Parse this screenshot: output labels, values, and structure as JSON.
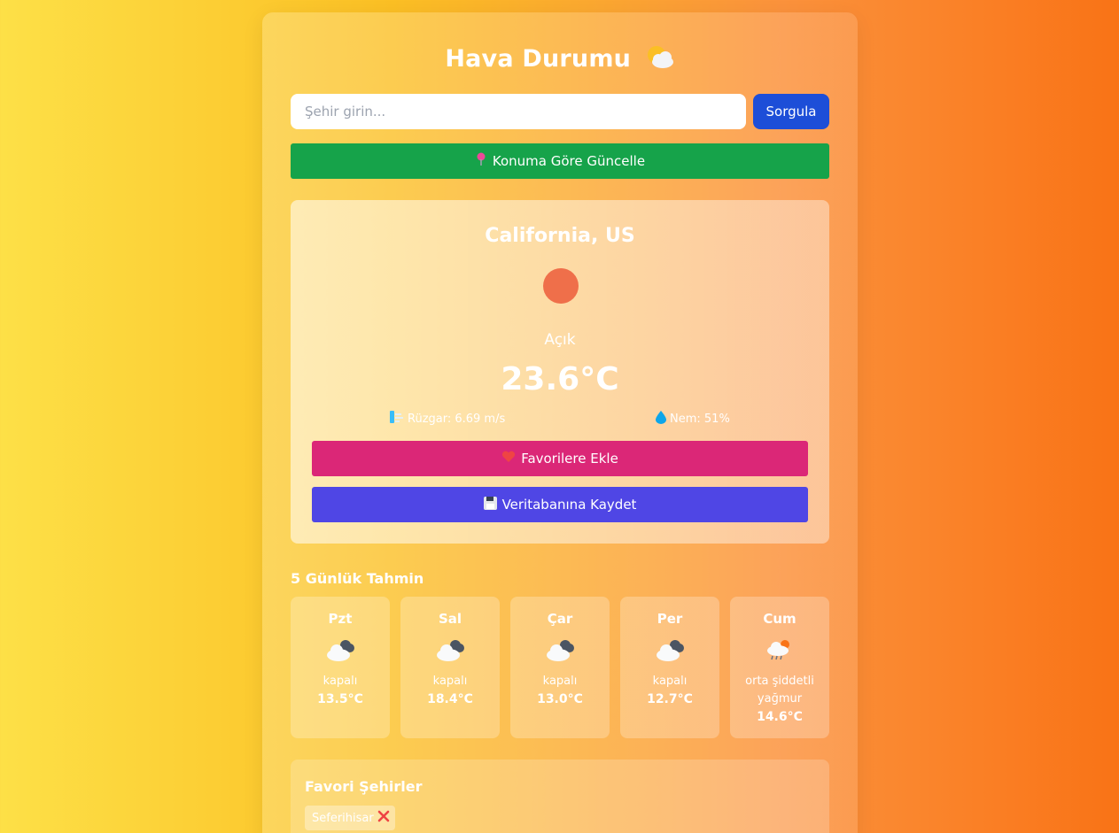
{
  "header": {
    "title": "Hava Durumu"
  },
  "search": {
    "placeholder": "Şehir girin...",
    "button_label": "Sorgula"
  },
  "location_button": {
    "label": "Konuma Göre Güncelle"
  },
  "current": {
    "city": "California, US",
    "description": "Açık",
    "temperature": "23.6°C",
    "wind": "Rüzgar: 6.69 m/s",
    "humidity": "Nem: 51%",
    "icon": "sun-icon"
  },
  "actions": {
    "favorite_label": "Favorilere Ekle",
    "save_label": "Veritabanına Kaydet"
  },
  "forecast": {
    "title": "5 Günlük Tahmin",
    "days": [
      {
        "day": "Pzt",
        "desc": "kapalı",
        "temp": "13.5°C",
        "icon": "cloudy-icon"
      },
      {
        "day": "Sal",
        "desc": "kapalı",
        "temp": "18.4°C",
        "icon": "cloudy-icon"
      },
      {
        "day": "Çar",
        "desc": "kapalı",
        "temp": "13.0°C",
        "icon": "cloudy-icon"
      },
      {
        "day": "Per",
        "desc": "kapalı",
        "temp": "12.7°C",
        "icon": "cloudy-icon"
      },
      {
        "day": "Cum",
        "desc": "orta şiddetli yağmur",
        "temp": "14.6°C",
        "icon": "rain-icon"
      }
    ]
  },
  "favorites": {
    "title": "Favori Şehirler",
    "cities": [
      "Seferihisar"
    ]
  },
  "colors": {
    "search_button": "#1d4ed8",
    "location_button": "#16a34a",
    "favorite_button": "#db2777",
    "save_button": "#4f46e5",
    "sun": "#ef6f4a"
  }
}
